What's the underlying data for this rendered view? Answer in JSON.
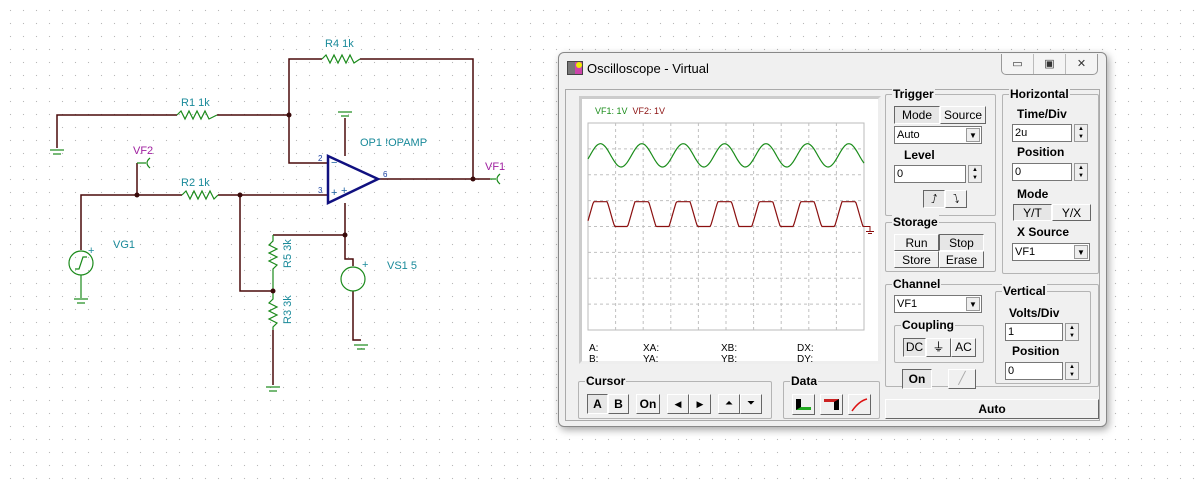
{
  "schematic": {
    "r4": "R4 1k",
    "r1": "R1 1k",
    "r2": "R2 1k",
    "r5": "R5 3k",
    "r3": "R3 3k",
    "opamp": "OP1 !OPAMP",
    "vg1": "VG1",
    "vs1": "VS1 5",
    "vf1": "VF1",
    "vf2": "VF2",
    "pin2": "2",
    "pin3": "3",
    "pin6": "6"
  },
  "window": {
    "title": "Oscilloscope - Virtual",
    "minimize": "▭",
    "maximize": "▣",
    "close": "✕"
  },
  "screen": {
    "ch1_label": "VF1: 1V",
    "ch2_label": "VF2: 1V",
    "cursor": {
      "a": "A:",
      "b": "B:",
      "xa": "XA:",
      "ya": "YA:",
      "xb": "XB:",
      "yb": "YB:",
      "dx": "DX:",
      "dy": "DY:"
    }
  },
  "colors": {
    "ch1": "#1a8c1a",
    "ch2": "#8b1010",
    "grid": "#c0c0c0"
  },
  "chart_data": {
    "type": "line",
    "x_divs": 10,
    "y_divs": 8,
    "time_per_div_us": 2,
    "volts_per_div": 1,
    "ground_div_from_top": 4,
    "series": [
      {
        "name": "VF1",
        "period_us": 3,
        "offset_v": 2.75,
        "amplitude_v": 0.45,
        "trough_at_us": 2.4,
        "clip": [
          0,
          10
        ]
      },
      {
        "name": "VF2",
        "period_us": 3,
        "offset_v": 0.5,
        "amplitude_v": 0.9,
        "trough_at_us": 2.4,
        "clip": [
          0,
          0.96
        ]
      }
    ]
  },
  "cursor_group": {
    "title": "Cursor",
    "a": "A",
    "b": "B",
    "on": "On",
    "left": "◀",
    "right": "▶",
    "up": "⏶",
    "down": "⏷"
  },
  "data_group": {
    "title": "Data"
  },
  "trigger": {
    "title": "Trigger",
    "mode": "Mode",
    "source": "Source",
    "mode_value": "Auto",
    "level_label": "Level",
    "level_value": "0",
    "rise": "⨍",
    "fall": "⨍"
  },
  "storage": {
    "title": "Storage",
    "run": "Run",
    "stop": "Stop",
    "store": "Store",
    "erase": "Erase"
  },
  "horizontal": {
    "title": "Horizontal",
    "time_label": "Time/Div",
    "time_value": "2u",
    "pos_label": "Position",
    "pos_value": "0",
    "mode_label": "Mode",
    "yt": "Y/T",
    "yx": "Y/X",
    "xsrc_label": "X Source",
    "xsrc_value": "VF1"
  },
  "channel": {
    "title": "Channel",
    "value": "VF1",
    "coupling": "Coupling",
    "dc": "DC",
    "gnd": "⏚",
    "ac": "AC",
    "on": "On"
  },
  "vertical": {
    "title": "Vertical",
    "volts_label": "Volts/Div",
    "volts_value": "1",
    "pos_label": "Position",
    "pos_value": "0"
  },
  "auto_button": "Auto"
}
